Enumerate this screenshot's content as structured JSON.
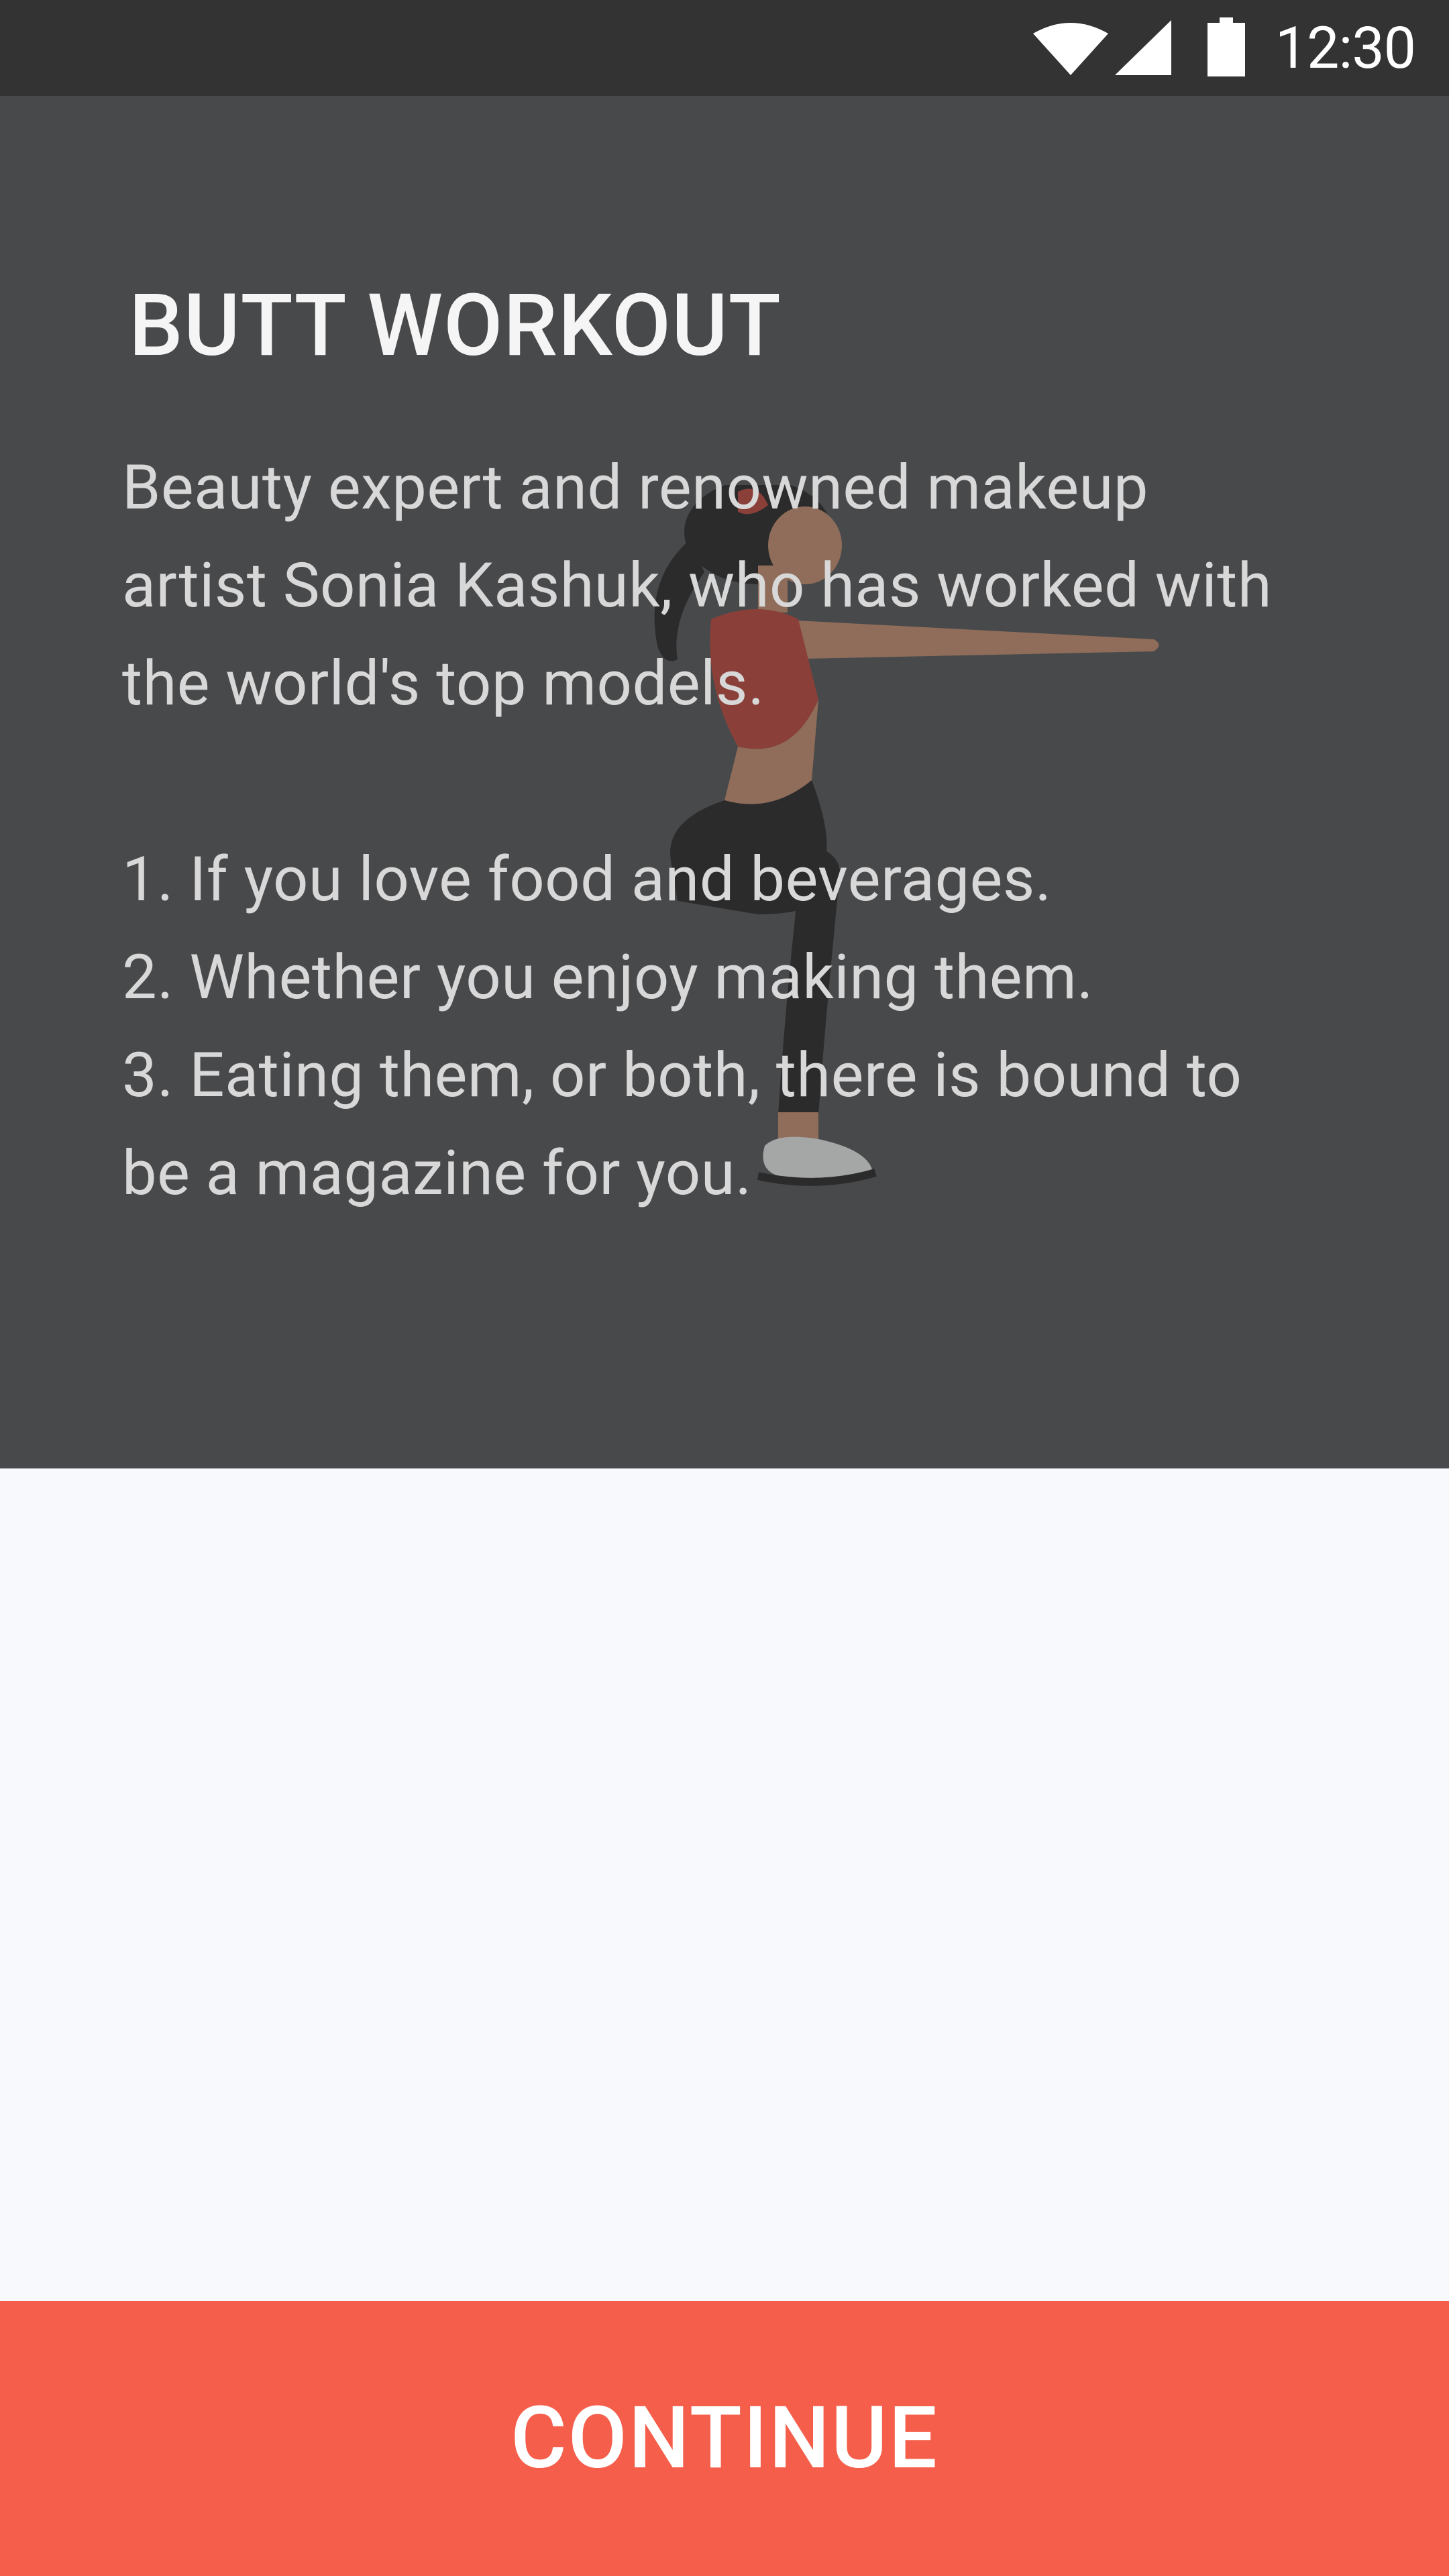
{
  "status_bar": {
    "time": "12:30",
    "icons": [
      "wifi-icon",
      "cellular-signal-icon",
      "battery-icon"
    ]
  },
  "card": {
    "title": "BUTT WORKOUT",
    "intro_lines": [
      "Beauty expert and renowned makeup",
      "artist Sonia Kashuk, who has worked with",
      "the world's top models."
    ],
    "list_lines": [
      "1. If you love food and beverages.",
      "2. Whether you enjoy making them.",
      "3. Eating them, or both, there is bound to",
      "be a magazine for you."
    ],
    "illustration": "woman-squat-illustration"
  },
  "footer": {
    "continue_label": "CONTINUE"
  },
  "colors": {
    "status_bar": "#333333",
    "overlay": "#48494b",
    "background": "#f8f9fd",
    "accent": "#f45e4a"
  }
}
